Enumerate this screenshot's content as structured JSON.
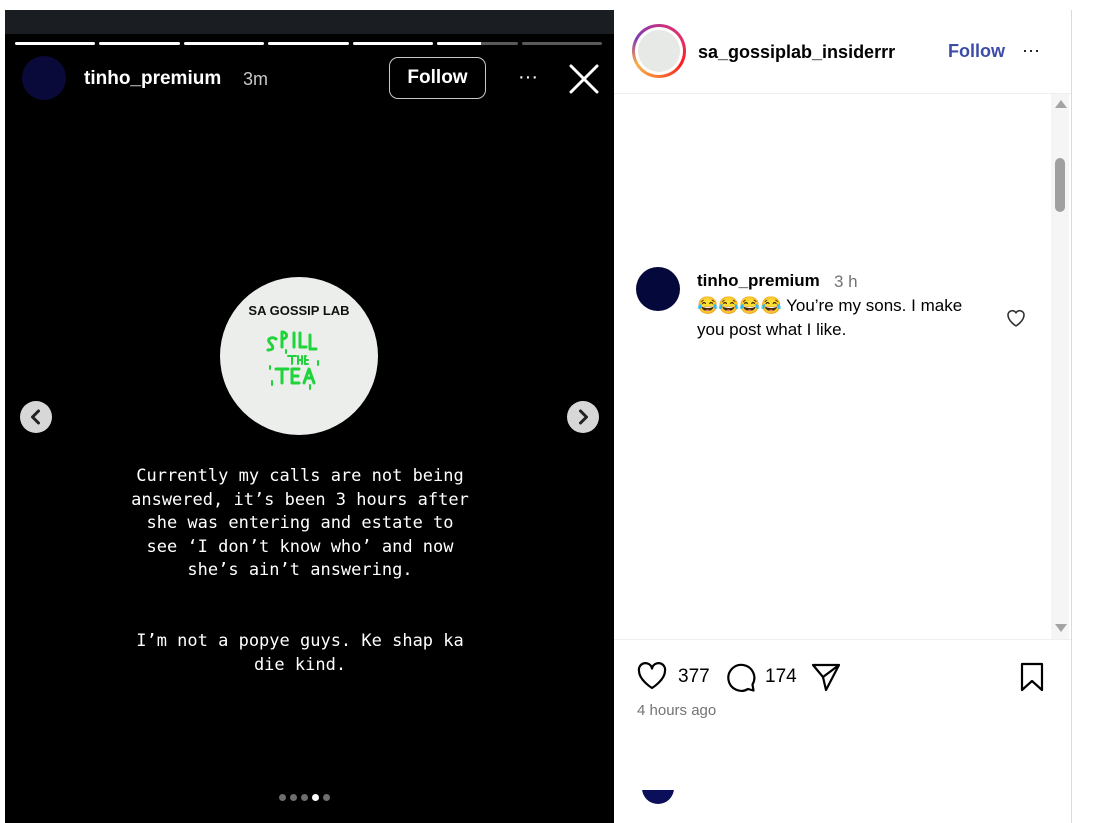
{
  "story": {
    "progress": [
      1,
      1,
      1,
      1,
      1,
      0.55,
      0
    ],
    "username": "tinho_premium",
    "time": "3m",
    "follow_label": "Follow",
    "more_label": "···",
    "close_icon": "close-icon",
    "logo_text": "SA GOSSIP LAB",
    "logo_tagline": "SPILL the TEA",
    "body_text": "Currently my calls are not being\nanswered, it’s been 3 hours after\nshe was entering and estate to\nsee ‘I don’t know who’ and now\nshe’s ain’t answering.",
    "body_text_2": "I’m not a popye guys. Ke shap ka\ndie kind.",
    "prev_icon": "chevron-left-icon",
    "next_icon": "chevron-right-icon",
    "page_dots": 5,
    "active_dot": 4
  },
  "post": {
    "username": "sa_gossiplab_insiderrr",
    "follow_label": "Follow",
    "more_label": "···",
    "comment": {
      "username": "tinho_premium",
      "time": "3 h",
      "text": "😂😂😂😂 You’re my sons. I make you post what I like."
    },
    "likes": "377",
    "comments": "174",
    "posted": "4 hours ago"
  },
  "colors": {
    "story_bg": "#000000",
    "follow_blue": "#3c4ca8",
    "tea_green": "#1fd33a"
  }
}
